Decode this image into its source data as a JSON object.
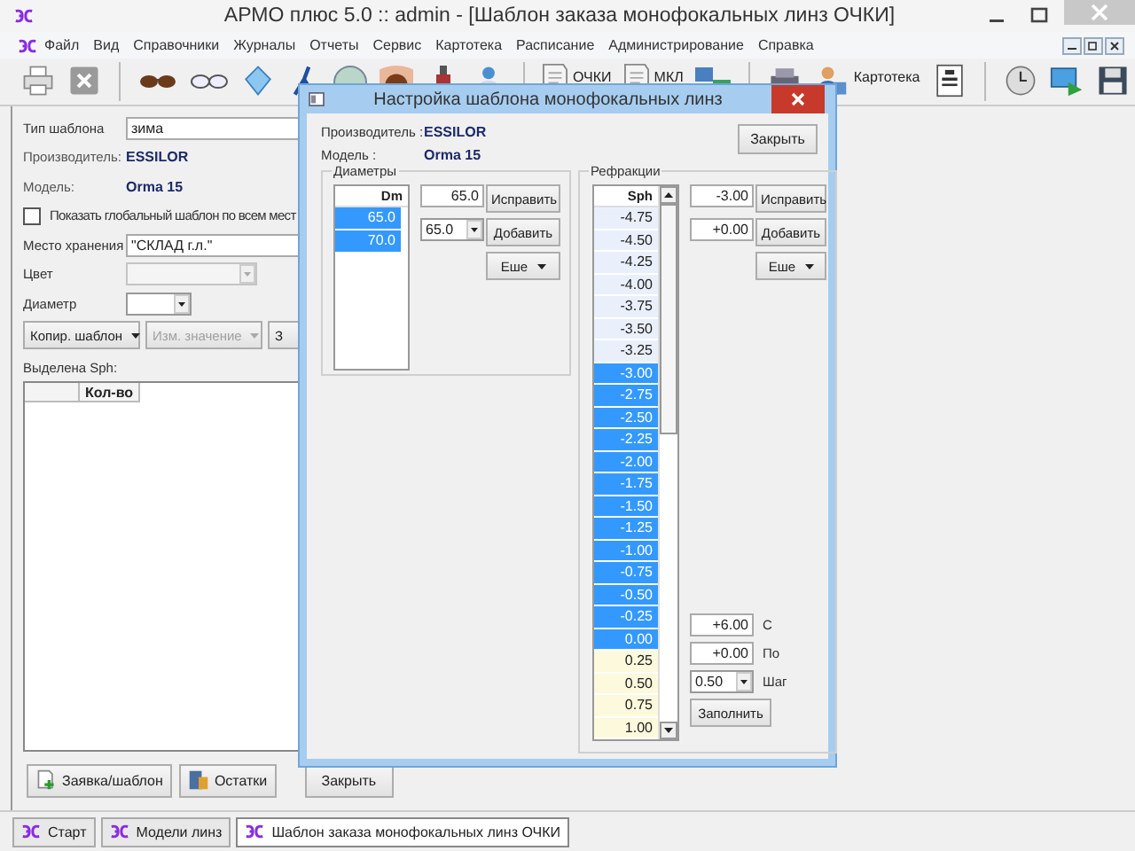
{
  "window": {
    "title": "АРМО плюс 5.0 :: admin - [Шаблон заказа монофокальных линз ОЧКИ]"
  },
  "menu": [
    "Файл",
    "Вид",
    "Справочники",
    "Журналы",
    "Отчеты",
    "Сервис",
    "Картотека",
    "Расписание",
    "Администрирование",
    "Справка"
  ],
  "toolbar": [
    {
      "kind": "printer"
    },
    {
      "kind": "cancel"
    },
    {
      "kind": "separator"
    },
    {
      "kind": "sunglasses"
    },
    {
      "kind": "glasses"
    },
    {
      "kind": "crystal"
    },
    {
      "kind": "pliers"
    },
    {
      "kind": "sphere"
    },
    {
      "kind": "eye"
    },
    {
      "kind": "bottle"
    },
    {
      "kind": "doctor"
    },
    {
      "kind": "separator"
    },
    {
      "kind": "document",
      "label": "ОЧКИ"
    },
    {
      "kind": "document",
      "label": "МКЛ"
    },
    {
      "kind": "computers"
    },
    {
      "kind": "separator"
    },
    {
      "kind": "machine"
    },
    {
      "kind": "person",
      "label": "Картотека"
    },
    {
      "kind": "chart"
    },
    {
      "kind": "separator"
    },
    {
      "kind": "clock"
    },
    {
      "kind": "monitor"
    },
    {
      "kind": "save"
    }
  ],
  "form": {
    "template_type": {
      "label": "Тип шаблона",
      "value": "зима"
    },
    "manufacturer": {
      "label": "Производитель:",
      "value": "ESSILOR"
    },
    "model": {
      "label": "Модель:",
      "value": "Orma 15"
    },
    "global_template": {
      "label": "Показать глобальный шаблон по всем мест",
      "checked": false
    },
    "storage": {
      "label": "Место хранения",
      "value": "\"СКЛАД г.л.\""
    },
    "color": {
      "label": "Цвет",
      "disabled": true
    },
    "diameter": {
      "label": "Диаметр",
      "disabled": false
    },
    "buttons": [
      {
        "label": "Копир. шаблон",
        "disabled": false
      },
      {
        "label": "Изм. значение",
        "disabled": true
      },
      {
        "label": "З"
      }
    ],
    "selected_label": "Выделена Sph:",
    "table": {
      "columns": [
        {
          "label": "Кол-во"
        }
      ]
    }
  },
  "bottom_buttons": [
    {
      "label": "Заявка/шаблон",
      "kind": "request"
    },
    {
      "label": "Остатки",
      "kind": "stock"
    },
    {
      "label": "Закрыть",
      "kind": "plain"
    }
  ],
  "tabs": [
    {
      "label": "Старт",
      "selected": false
    },
    {
      "label": "Модели линз",
      "selected": false
    },
    {
      "label": "Шаблон заказа монофокальных линз ОЧКИ",
      "selected": true
    }
  ],
  "dialog": {
    "title": "Настройка шаблона монофокальных линз",
    "manufacturer": {
      "label": "Производитель :",
      "value": "ESSILOR"
    },
    "model": {
      "label": "Модель :",
      "value": "Orma 15"
    },
    "close_button": "Закрыть",
    "diameters": {
      "title": "Диаметры",
      "column": "Dm",
      "rows": [
        {
          "value": "65.0",
          "selected": true
        },
        {
          "value": "70.0",
          "selected": true
        }
      ],
      "field": "65.0",
      "combo": "65.0",
      "fix_button": "Исправить",
      "add_button": "Добавить",
      "more_button": "Еше"
    },
    "refractions": {
      "title": "Рефракции",
      "column": "Sph",
      "rows": [
        {
          "value": "-4.75",
          "selected": false,
          "color": "#eaf0fb"
        },
        {
          "value": "-4.50",
          "selected": false,
          "color": "#eaf0fb"
        },
        {
          "value": "-4.25",
          "selected": false,
          "color": "#eaf0fb"
        },
        {
          "value": "-4.00",
          "selected": false,
          "color": "#eaf0fb"
        },
        {
          "value": "-3.75",
          "selected": false,
          "color": "#eaf0fb"
        },
        {
          "value": "-3.50",
          "selected": false,
          "color": "#eaf0fb"
        },
        {
          "value": "-3.25",
          "selected": false,
          "color": "#eaf0fb"
        },
        {
          "value": "-3.00",
          "selected": true
        },
        {
          "value": "-2.75",
          "selected": true
        },
        {
          "value": "-2.50",
          "selected": true
        },
        {
          "value": "-2.25",
          "selected": true
        },
        {
          "value": "-2.00",
          "selected": true
        },
        {
          "value": "-1.75",
          "selected": true
        },
        {
          "value": "-1.50",
          "selected": true
        },
        {
          "value": "-1.25",
          "selected": true
        },
        {
          "value": "-1.00",
          "selected": true
        },
        {
          "value": "-0.75",
          "selected": true
        },
        {
          "value": "-0.50",
          "selected": true
        },
        {
          "value": "-0.25",
          "selected": true
        },
        {
          "value": "0.00",
          "selected": true
        },
        {
          "value": "0.25",
          "selected": false,
          "color": "#fdf9dc"
        },
        {
          "value": "0.50",
          "selected": false,
          "color": "#fdf9dc"
        },
        {
          "value": "0.75",
          "selected": false,
          "color": "#fdf9dc"
        },
        {
          "value": "1.00",
          "selected": false,
          "color": "#fdf9dc"
        }
      ],
      "field_1": "-3.00",
      "field_2": "+0.00",
      "fix_button": "Исправить",
      "add_button": "Добавить",
      "more_button": "Еше",
      "from": {
        "label": "С",
        "value": "+6.00"
      },
      "to": {
        "label": "По",
        "value": "+0.00"
      },
      "step": {
        "label": "Шаг",
        "value": "0.50"
      },
      "fill_button": "Заполнить"
    }
  }
}
